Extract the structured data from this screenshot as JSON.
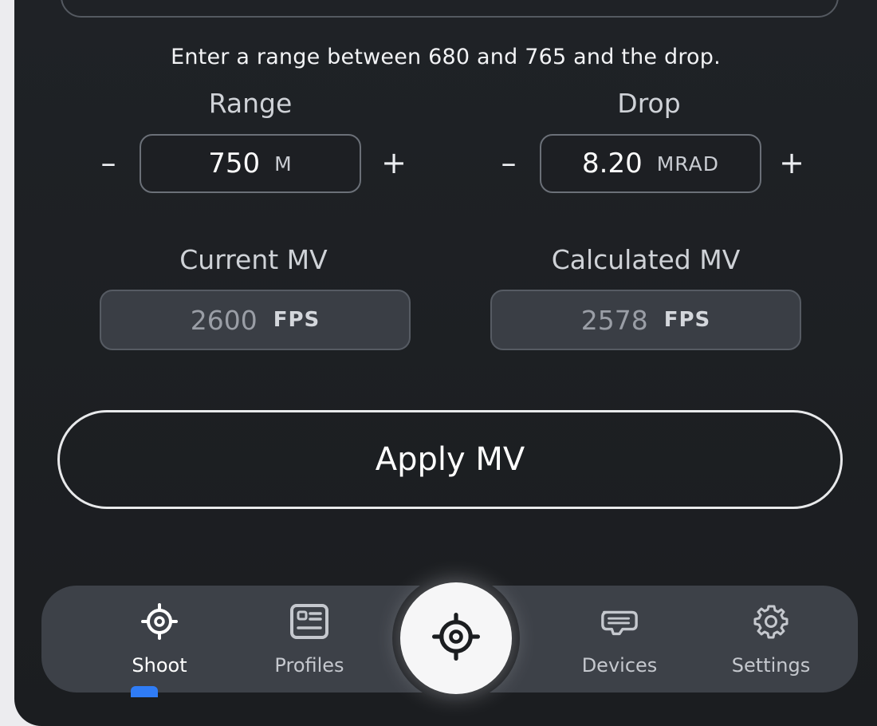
{
  "instructions": "Enter a range between 680 and 765 and the drop.",
  "range": {
    "label": "Range",
    "value": "750",
    "unit": "M",
    "minus": "–",
    "plus": "+"
  },
  "drop": {
    "label": "Drop",
    "value": "8.20",
    "unit": "MRAD",
    "minus": "–",
    "plus": "+"
  },
  "current_mv": {
    "label": "Current MV",
    "value": "2600",
    "unit": "FPS"
  },
  "calculated_mv": {
    "label": "Calculated MV",
    "value": "2578",
    "unit": "FPS"
  },
  "apply_button": "Apply MV",
  "nav": {
    "active_tab": "Shoot",
    "tabs": [
      {
        "label": "Shoot",
        "icon": "crosshair-icon"
      },
      {
        "label": "Profiles",
        "icon": "id-card-icon"
      },
      {
        "label": "Devices",
        "icon": "device-icon"
      },
      {
        "label": "Settings",
        "icon": "gear-icon"
      }
    ],
    "center_icon": "crosshair-icon"
  },
  "colors": {
    "accent": "#2f7cf6",
    "background": "#1f2226",
    "tabbar": "#3d4148"
  }
}
